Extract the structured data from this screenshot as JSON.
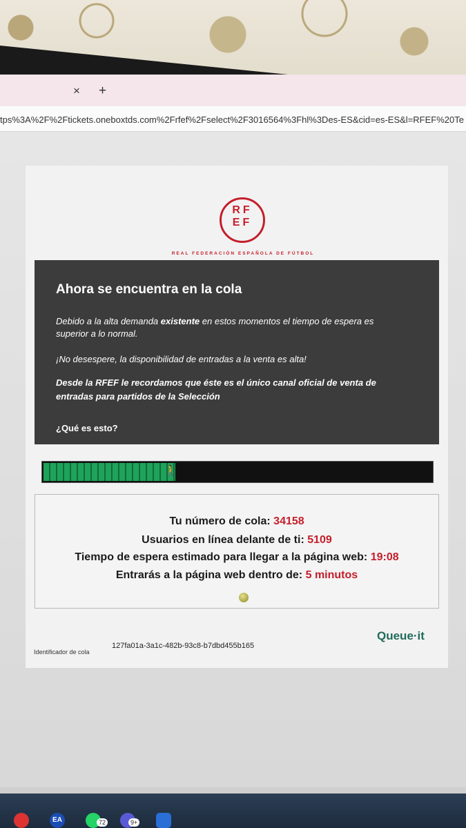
{
  "browser": {
    "tab_close_glyph": "×",
    "new_tab_glyph": "+",
    "url": "tps%3A%2F%2Ftickets.oneboxtds.com%2Frfef%2Fselect%2F3016564%3Fhl%3Des-ES&cid=es-ES&l=RFEF%20Te"
  },
  "logo": {
    "mark": "RF EF",
    "subtitle": "REAL FEDERACIÓN ESPAÑOLA DE FÚTBOL",
    "color": "#c41e2a"
  },
  "panel": {
    "title": "Ahora se encuentra en la cola",
    "p1_before": "Debido a la alta demanda ",
    "p1_bold": "existente",
    "p1_after": " en estos momentos el tiempo de espera es superior a lo normal.",
    "p2": "¡No desespere, la disponibilidad de entradas a la venta es alta!",
    "p3": "Desde la RFEF le recordamos que éste es el único canal oficial de venta de entradas para partidos de la Selección",
    "link": "¿Qué es esto?"
  },
  "progress": {
    "fraction": 0.34,
    "walker_icon": "walking-person-icon"
  },
  "queue": {
    "number_label": "Tu número de cola:",
    "number_value": "34158",
    "ahead_label": "Usuarios en línea delante de ti:",
    "ahead_value": "5109",
    "wait_label": "Tiempo de espera estimado para llegar a la página web:",
    "wait_value": "19:08",
    "enter_label": "Entrarás a la página web dentro de:",
    "enter_value": "5 minutos"
  },
  "footer": {
    "id_label": "Identificador de cola",
    "id_value": "127fa01a-3a1c-482b-93c8-b7dbd455b165",
    "brand": "Queue·it"
  },
  "taskbar": {
    "ea_label": "EA",
    "whatsapp_badge": "72",
    "app_badge": "9+"
  }
}
